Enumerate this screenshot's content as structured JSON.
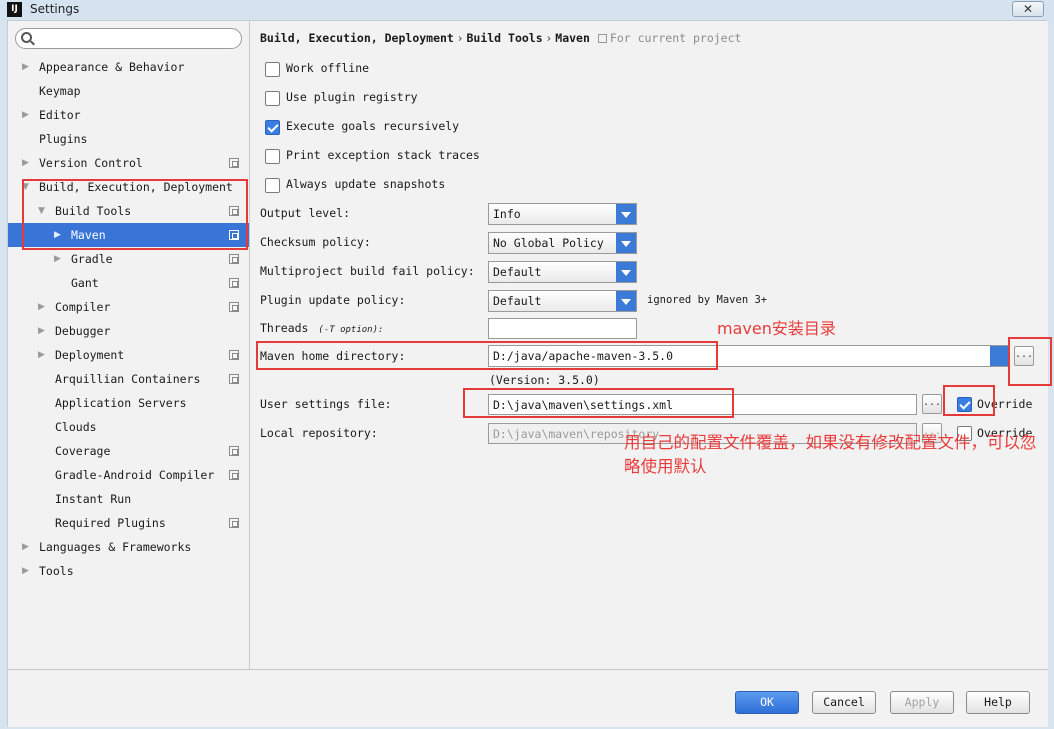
{
  "window": {
    "title": "Settings",
    "app_icon": "IJ",
    "close_glyph": "✕"
  },
  "search": {
    "placeholder": ""
  },
  "sidebar": {
    "items": [
      {
        "label": "Appearance & Behavior",
        "arrow": "▶"
      },
      {
        "label": "Keymap"
      },
      {
        "label": "Editor",
        "arrow": "▶"
      },
      {
        "label": "Plugins"
      },
      {
        "label": "Version Control",
        "arrow": "▶"
      },
      {
        "label": "Build, Execution, Deployment",
        "arrow": "▼"
      },
      {
        "label": "Build Tools",
        "arrow": "▼"
      },
      {
        "label": "Maven",
        "arrow": "▶"
      },
      {
        "label": "Gradle",
        "arrow": "▶"
      },
      {
        "label": "Gant"
      },
      {
        "label": "Compiler",
        "arrow": "▶"
      },
      {
        "label": "Debugger",
        "arrow": "▶"
      },
      {
        "label": "Deployment",
        "arrow": "▶"
      },
      {
        "label": "Arquillian Containers"
      },
      {
        "label": "Application Servers"
      },
      {
        "label": "Clouds"
      },
      {
        "label": "Coverage"
      },
      {
        "label": "Gradle-Android Compiler"
      },
      {
        "label": "Instant Run"
      },
      {
        "label": "Required Plugins"
      },
      {
        "label": "Languages & Frameworks",
        "arrow": "▶"
      },
      {
        "label": "Tools",
        "arrow": "▶"
      }
    ]
  },
  "breadcrumb": {
    "parts": [
      "Build, Execution, Deployment",
      "Build Tools",
      "Maven"
    ],
    "separator": "›",
    "scope": "For current project"
  },
  "checkboxes": [
    {
      "label": "Work offline",
      "checked": false
    },
    {
      "label": "Use plugin registry",
      "checked": false
    },
    {
      "label": "Execute goals recursively",
      "checked": true
    },
    {
      "label": "Print exception stack traces",
      "checked": false
    },
    {
      "label": "Always update snapshots",
      "checked": false
    }
  ],
  "form": {
    "output_level": {
      "label": "Output level:",
      "value": "Info"
    },
    "checksum_policy": {
      "label": "Checksum policy:",
      "value": "No Global Policy"
    },
    "multiproject_policy": {
      "label": "Multiproject build fail policy:",
      "value": "Default"
    },
    "plugin_update_policy": {
      "label": "Plugin update policy:",
      "value": "Default",
      "note": "ignored by Maven 3+"
    },
    "threads": {
      "label": "Threads",
      "sub": "(-T option):",
      "value": ""
    },
    "maven_home": {
      "label": "Maven home directory:",
      "value": "D:/java/apache-maven-3.5.0",
      "version": "(Version: 3.5.0)",
      "browse": "..."
    },
    "user_settings": {
      "label": "User settings file:",
      "value": "D:\\java\\maven\\settings.xml",
      "browse": "...",
      "override_label": "Override",
      "override_checked": true
    },
    "local_repo": {
      "label": "Local repository:",
      "value": "D:\\java\\maven\\repository",
      "browse": "...",
      "override_label": "Override",
      "override_checked": false
    }
  },
  "annotations": {
    "maven_home_note": "maven安装目录",
    "settings_note": "用自己的配置文件覆盖，如果没有修改配置文件，可以忽略使用默认"
  },
  "buttons": {
    "ok": "OK",
    "cancel": "Cancel",
    "apply": "Apply",
    "help": "Help"
  },
  "colors": {
    "selection": "#3875d7",
    "accent": "#3b7ad6",
    "annotation_red": "#e43a3a"
  }
}
